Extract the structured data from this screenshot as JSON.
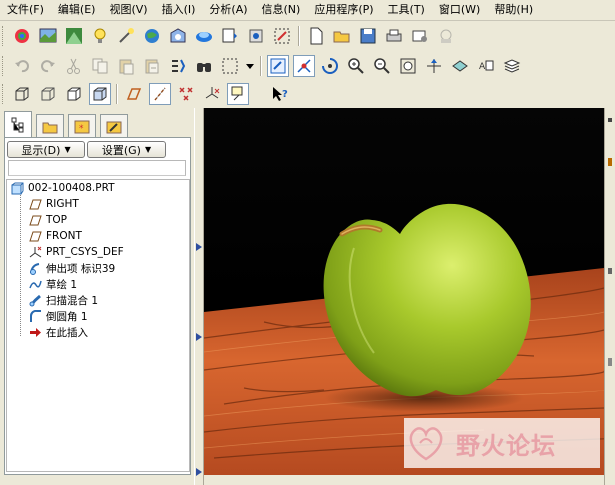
{
  "menu": [
    "文件(F)",
    "编辑(E)",
    "视图(V)",
    "插入(I)",
    "分析(A)",
    "信息(N)",
    "应用程序(P)",
    "工具(T)",
    "窗口(W)",
    "帮助(H)"
  ],
  "navigator": {
    "tabs": [
      "model-tree-tab",
      "folder-browser-tab",
      "favorites-tab",
      "connections-tab"
    ],
    "show_button": "显示(D)",
    "settings_button": "设置(G)",
    "tree": [
      {
        "label": "002-100408.PRT",
        "icon": "part-icon"
      },
      {
        "label": "RIGHT",
        "icon": "datum-plane-icon"
      },
      {
        "label": "TOP",
        "icon": "datum-plane-icon"
      },
      {
        "label": "FRONT",
        "icon": "datum-plane-icon"
      },
      {
        "label": "PRT_CSYS_DEF",
        "icon": "csys-icon"
      },
      {
        "label": "伸出项 标识39",
        "icon": "protrusion-icon"
      },
      {
        "label": "草绘 1",
        "icon": "sketch-icon"
      },
      {
        "label": "扫描混合 1",
        "icon": "swept-blend-icon"
      },
      {
        "label": "倒圆角 1",
        "icon": "round-icon"
      },
      {
        "label": "在此插入",
        "icon": "insert-here-arrow-icon"
      }
    ]
  },
  "viewport": {
    "scene": "3d-apple-model-on-wood-table",
    "apple_color": "#9bc22a",
    "table_color": "#c8552a"
  },
  "watermark": {
    "text": "野火论坛"
  }
}
